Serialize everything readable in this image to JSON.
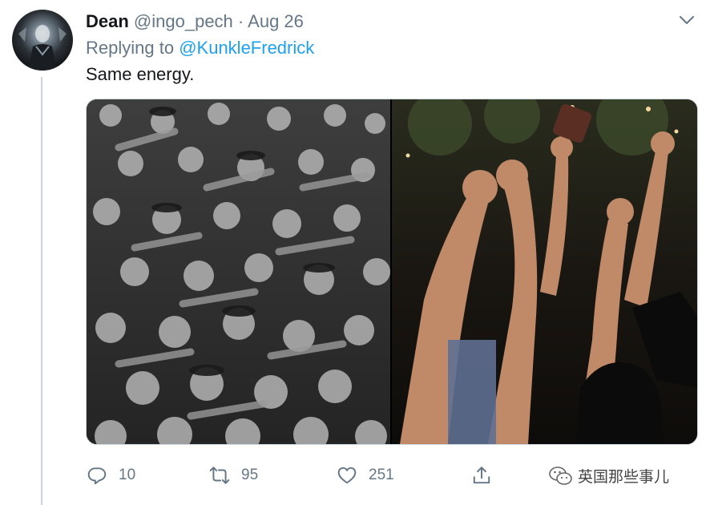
{
  "tweet": {
    "author": {
      "display_name": "Dean",
      "handle": "@ingo_pech",
      "separator": "·",
      "date": "Aug 26"
    },
    "reply_prefix": "Replying to",
    "reply_to": "@KunkleFredrick",
    "text": "Same energy.",
    "media": {
      "left": {
        "icon": "crowd-saluting-photo"
      },
      "right": {
        "icon": "crowd-raised-fists-photo"
      }
    },
    "actions": {
      "reply_count": "10",
      "retweet_count": "95",
      "like_count": "251"
    }
  },
  "watermark": {
    "text": "英国那些事儿"
  },
  "colors": {
    "accent": "#1da1f2",
    "secondary_text": "#657786",
    "primary_text": "#14171a",
    "divider": "#ccd6dd"
  }
}
